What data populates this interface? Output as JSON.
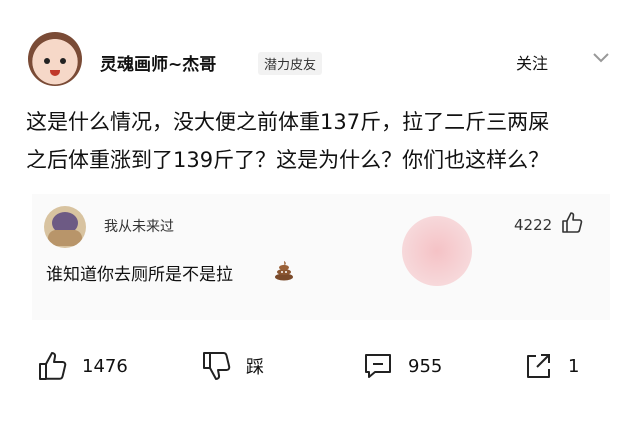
{
  "header": {
    "username": "灵魂画师~杰哥",
    "badge": "潜力皮友",
    "follow_label": "关注"
  },
  "post": {
    "line1": "这是什么情况，没大便之前体重137斤，拉了二斤三两屎",
    "line2": "之后体重涨到了139斤了？这是为什么？你们也这样么？"
  },
  "comment": {
    "author": "我从未来过",
    "likes": "4222",
    "text": "谁知道你去厕所是不是拉"
  },
  "actions": {
    "like_count": "1476",
    "dislike_label": "踩",
    "comment_count": "955",
    "share_count": "1"
  },
  "icons": {
    "follow_menu": "chevron-down-icon",
    "comment_like": "thumbs-up-icon",
    "poop": "poop-emoji-icon",
    "like": "thumbs-up-icon",
    "dislike": "thumbs-down-icon",
    "comment": "comment-icon",
    "share": "share-icon"
  }
}
